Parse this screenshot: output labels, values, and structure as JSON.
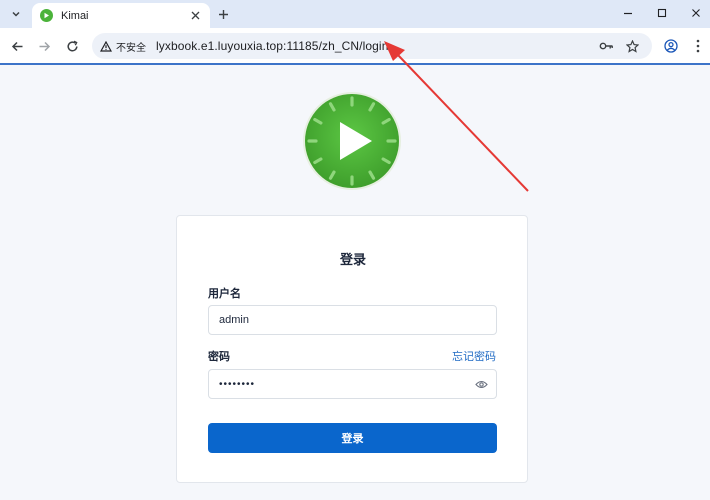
{
  "browser": {
    "tab": {
      "title": "Kimai",
      "favicon": "kimai-play-icon"
    },
    "address_bar": {
      "security_label": "不安全",
      "url": "lyxbook.e1.luyouxia.top:11185/zh_CN/login"
    },
    "icons": {
      "tab_search": "chevron-down-icon",
      "back": "arrow-left-icon",
      "forward": "arrow-right-icon",
      "reload": "reload-icon",
      "password_key": "key-icon",
      "bookmark": "star-icon",
      "profile": "profile-icon",
      "menu": "kebab-menu-icon"
    }
  },
  "login": {
    "title": "登录",
    "username_label": "用户名",
    "username_value": "admin",
    "password_label": "密码",
    "forgot_link": "忘记密码",
    "password_value": "••••••••",
    "submit_label": "登录"
  },
  "colors": {
    "accent": "#0a66cc",
    "link": "#206bc4",
    "logo_green": "#4bb33a",
    "annotation_arrow": "#e53935"
  }
}
